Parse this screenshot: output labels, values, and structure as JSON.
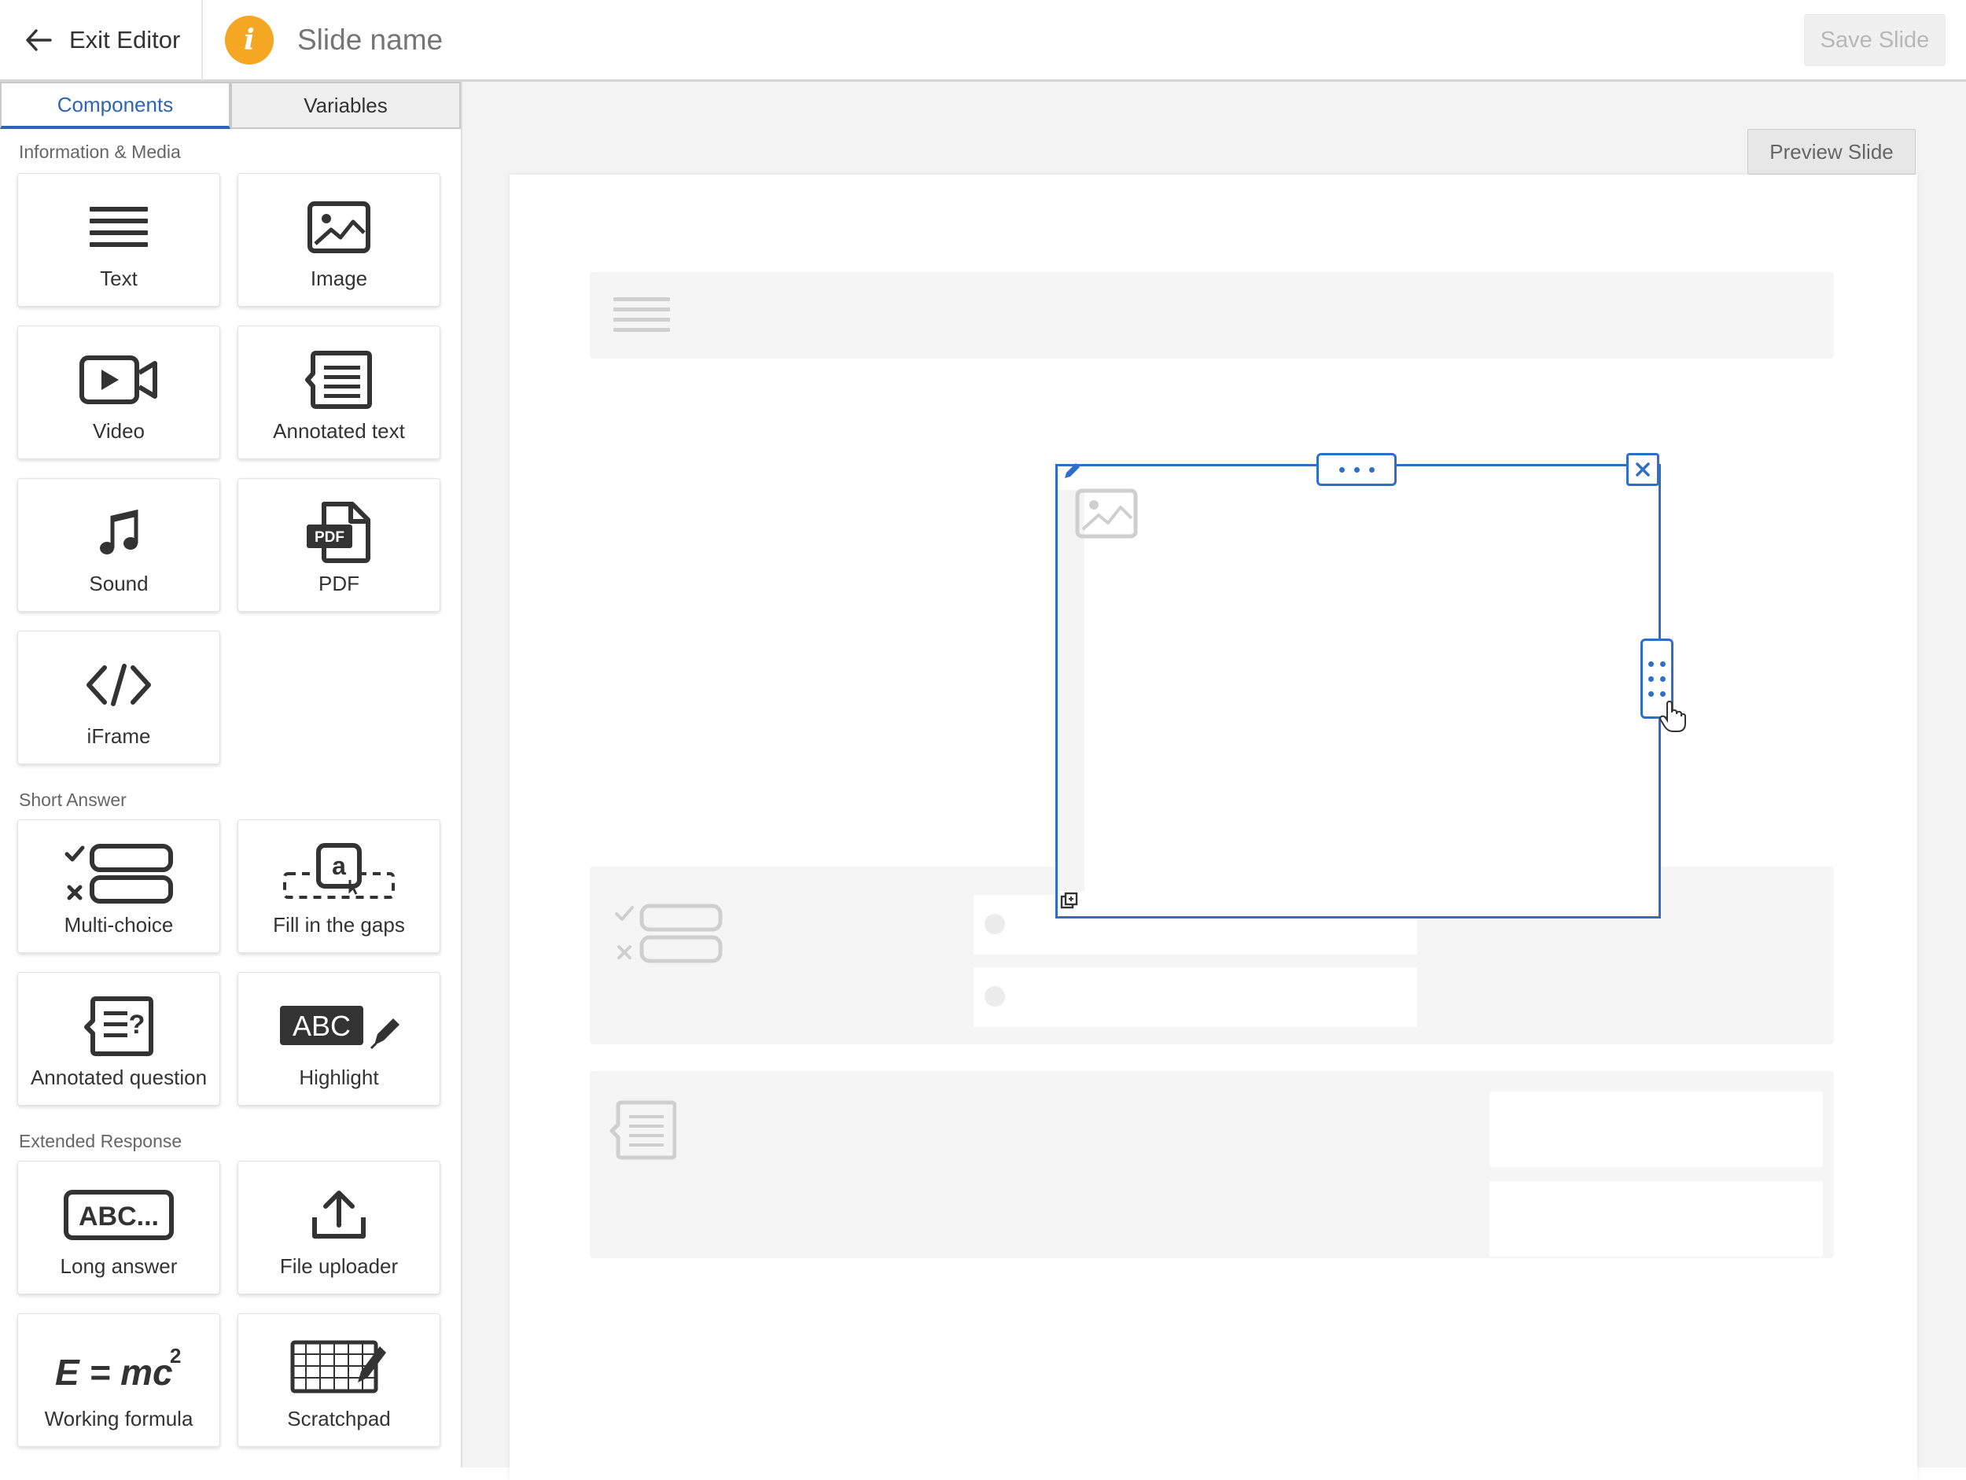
{
  "header": {
    "exit_label": "Exit Editor",
    "info_glyph": "i",
    "slide_name_placeholder": "Slide name",
    "save_label": "Save Slide",
    "accent_color": "#f5a623"
  },
  "panel": {
    "tabs": [
      {
        "label": "Components",
        "active": true
      },
      {
        "label": "Variables",
        "active": false
      }
    ],
    "sections": {
      "info_media": "Information & Media",
      "short_answer": "Short Answer",
      "extended": "Extended Response"
    },
    "components": {
      "text": {
        "label": "Text",
        "icon": "text-lines-icon"
      },
      "image": {
        "label": "Image",
        "icon": "image-icon"
      },
      "video": {
        "label": "Video",
        "icon": "video-camera-icon"
      },
      "annotated_text": {
        "label": "Annotated text",
        "icon": "annotated-text-icon"
      },
      "sound": {
        "label": "Sound",
        "icon": "music-note-icon"
      },
      "pdf": {
        "label": "PDF",
        "icon": "pdf-file-icon",
        "badge": "PDF"
      },
      "iframe": {
        "label": "iFrame",
        "icon": "code-brackets-icon"
      },
      "multi_choice": {
        "label": "Multi-choice",
        "icon": "multi-choice-icon"
      },
      "fill_gaps": {
        "label": "Fill in the gaps",
        "icon": "fill-gaps-icon",
        "glyph": "a"
      },
      "annotated_question": {
        "label": "Annotated question",
        "icon": "annotated-question-icon"
      },
      "highlight": {
        "label": "Highlight",
        "icon": "highlight-icon",
        "glyph": "ABC"
      },
      "long_answer": {
        "label": "Long answer",
        "icon": "long-answer-icon",
        "glyph": "ABC..."
      },
      "file_uploader": {
        "label": "File uploader",
        "icon": "upload-icon"
      },
      "working_formula": {
        "label": "Working formula",
        "icon": "formula-icon",
        "glyph": "E = mc",
        "sup": "2"
      },
      "scratchpad": {
        "label": "Scratchpad",
        "icon": "scratchpad-icon"
      }
    }
  },
  "canvas": {
    "preview_label": "Preview Slide",
    "selection_color": "#2f6fc9"
  }
}
